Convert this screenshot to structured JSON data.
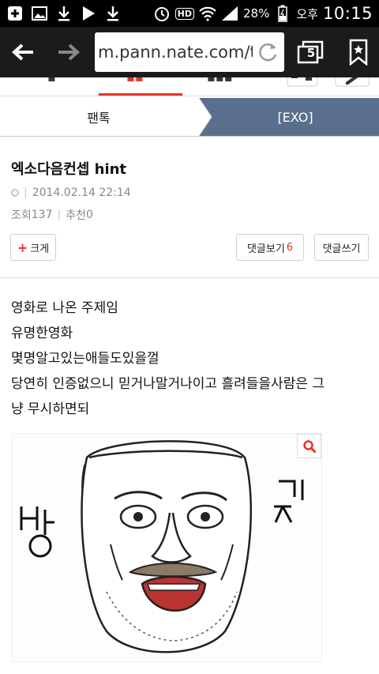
{
  "status_bar": {
    "battery_percent": "28%",
    "ampm": "오후",
    "time": "10:15",
    "hd_label": "HD",
    "left_icons": [
      "plus-box-icon",
      "image-icon",
      "download-icon",
      "play-icon",
      "download-icon"
    ],
    "right_icons": [
      "alarm-icon",
      "hd-icon",
      "wifi-icon",
      "signal-icon",
      "battery-charging-icon"
    ]
  },
  "browser": {
    "url": "m.pann.nate.com/talk",
    "tab_count": "5",
    "icons": [
      "back-arrow-icon",
      "forward-arrow-icon",
      "refresh-icon",
      "tabs-icon",
      "bookmark-icon"
    ]
  },
  "breadcrumb": {
    "left": "팬톡",
    "right": "[EXO]"
  },
  "post": {
    "title": "엑소다음컨셉 hint",
    "datetime": "2014.02.14 22:14",
    "views_label": "조회",
    "views": "137",
    "recommend_label": "추천",
    "recommend": "0",
    "size_button": "크게",
    "view_comments_label": "댓글보기",
    "comment_count": "6",
    "write_comment_label": "댓글쓰기",
    "body_lines": [
      "영화로 나온 주제임",
      "유명한영화",
      "몇명알고있는애들도있을껄",
      "당연히 인증없으니 믿거나말거나이고 흘려들을사람은 그",
      "냥 무시하면되"
    ]
  },
  "colors": {
    "accent_red": "#e5332a",
    "breadcrumb_blue": "#5a6f8c",
    "toolbar": "#1b1b1b"
  }
}
